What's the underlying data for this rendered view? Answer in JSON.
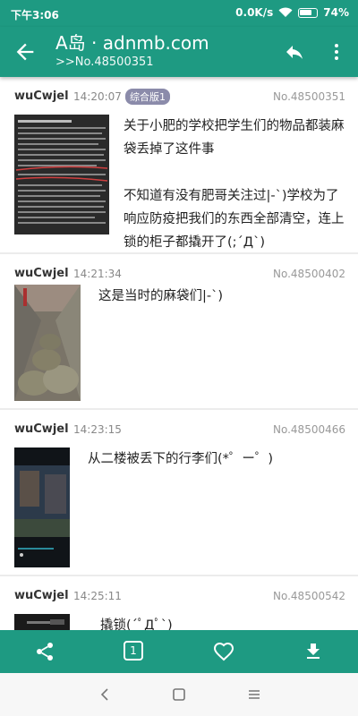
{
  "status_bar": {
    "time": "下午3:06",
    "net_speed": "0.0K/s",
    "battery": "74%"
  },
  "app_bar": {
    "title": "A岛 · adnmb.com",
    "subtitle": ">>No.48500351"
  },
  "posts": [
    {
      "author": "wuCwjel",
      "time": "14:20:07",
      "badge": "综合版1",
      "no": "No.48500351",
      "text": "关于小肥的学校把学生们的物品都装麻袋丢掉了这件事\n\n不知道有没有肥哥关注过|-`)学校为了响应防疫把我们的东西全部清空，连上锁的柜子都撬开了(;´Д`)"
    },
    {
      "author": "wuCwjel",
      "time": "14:21:34",
      "no": "No.48500402",
      "text": "这是当时的麻袋们|-`)"
    },
    {
      "author": "wuCwjel",
      "time": "14:23:15",
      "no": "No.48500466",
      "text": "从二楼被丢下的行李们(*゜ー゜)"
    },
    {
      "author": "wuCwjel",
      "time": "14:25:11",
      "no": "No.48500542",
      "text": "撬锁(´ﾟДﾟ`)"
    }
  ],
  "bottom_bar": {
    "page_number": "1"
  }
}
